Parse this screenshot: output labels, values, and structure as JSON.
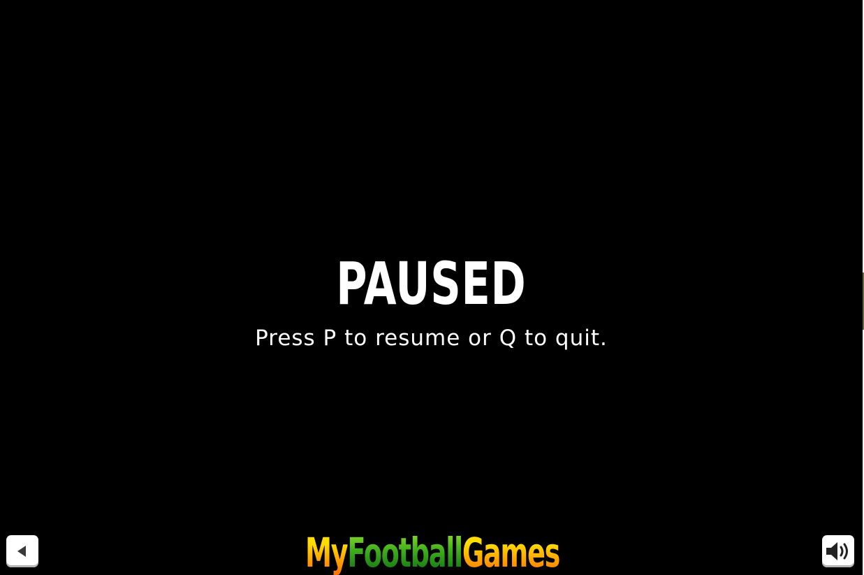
{
  "pause_overlay": {
    "title": "PAUSED",
    "instructions": "Press P to resume or Q to quit."
  },
  "controls": {
    "back_icon": "triangle-left-icon",
    "sound_icon": "speaker-volume-icon"
  },
  "logo": {
    "word_my": "My",
    "word_football": "Football",
    "word_games": "Games"
  },
  "colors": {
    "background": "#000000",
    "text": "#ffffff",
    "logo_yellow": "#ffdd00",
    "logo_orange": "#ff6a00",
    "logo_green": "#3fae1c"
  }
}
